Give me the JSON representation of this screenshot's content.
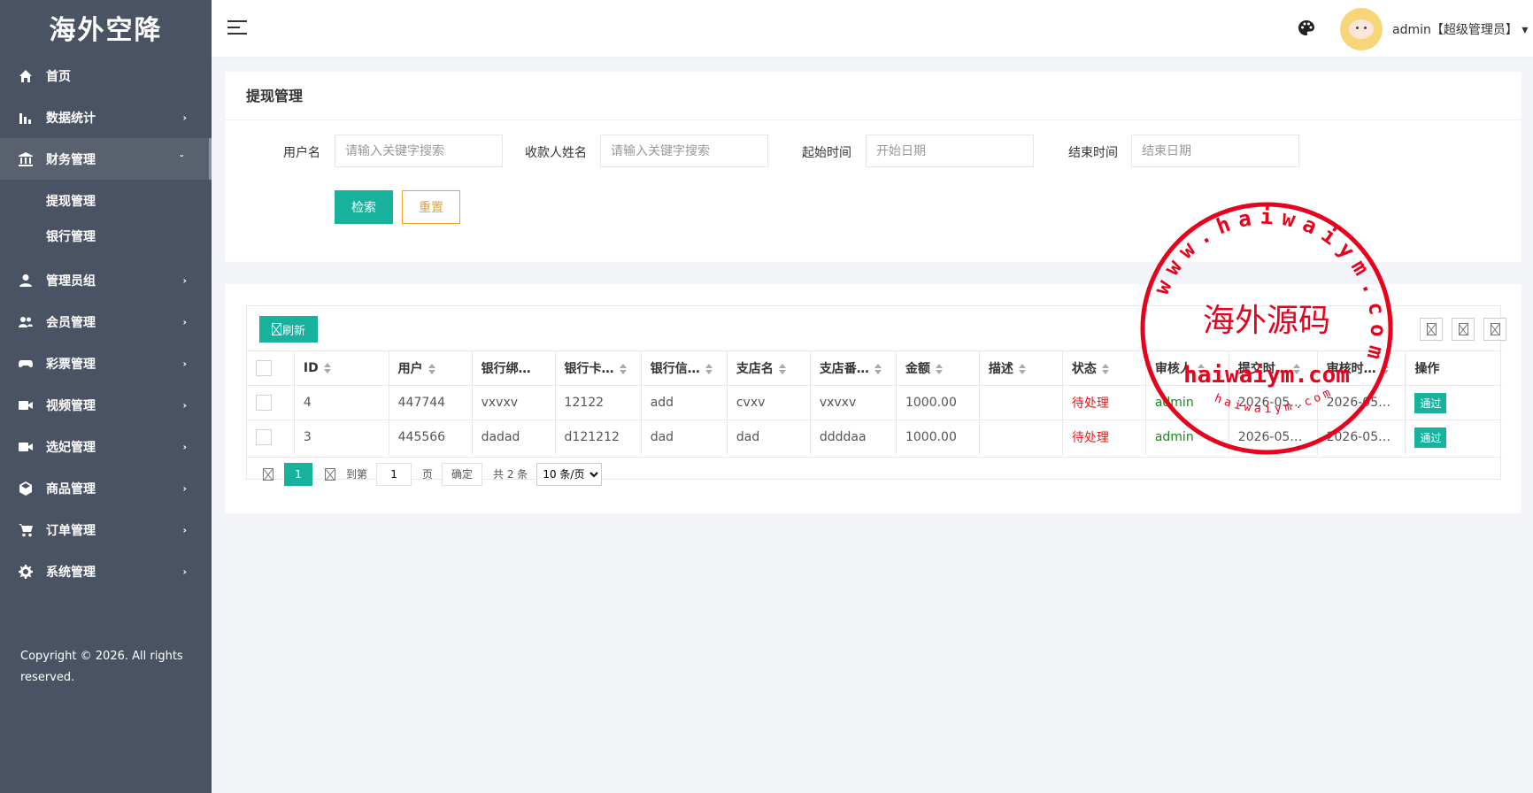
{
  "sidebar": {
    "brand": "海外空降",
    "items": [
      {
        "label": "首页",
        "icon": "home-icon"
      },
      {
        "label": "数据统计",
        "icon": "bar-chart-icon"
      },
      {
        "label": "财务管理",
        "icon": "bank-icon",
        "expanded": true
      },
      {
        "label": "管理员组",
        "icon": "user-icon"
      },
      {
        "label": "会员管理",
        "icon": "users-icon"
      },
      {
        "label": "彩票管理",
        "icon": "gamepad-icon"
      },
      {
        "label": "视频管理",
        "icon": "video-icon"
      },
      {
        "label": "选妃管理",
        "icon": "video-icon"
      },
      {
        "label": "商品管理",
        "icon": "cube-icon"
      },
      {
        "label": "订单管理",
        "icon": "cart-icon"
      },
      {
        "label": "系统管理",
        "icon": "gear-icon"
      }
    ],
    "subitems": [
      {
        "label": "提现管理"
      },
      {
        "label": "银行管理"
      }
    ],
    "copyright": "Copyright © 2026. All rights reserved."
  },
  "header": {
    "user": "admin【超级管理员】",
    "caret": "▾"
  },
  "search_panel": {
    "title": "提现管理",
    "fields": [
      {
        "label": "用户名",
        "placeholder": "请输入关键字搜索"
      },
      {
        "label": "收款人姓名",
        "placeholder": "请输入关键字搜索"
      },
      {
        "label": "起始时间",
        "placeholder": "开始日期"
      },
      {
        "label": "结束时间",
        "placeholder": "结束日期"
      }
    ],
    "search_button": "检索",
    "reset_button": "重置"
  },
  "table": {
    "refresh_button": "刷新",
    "columns": [
      "ID",
      "用户",
      "银行绑…",
      "银行卡…",
      "银行信…",
      "支店名",
      "支店番…",
      "金额",
      "描述",
      "状态",
      "审核人",
      "提交时…",
      "审核时…",
      "操作"
    ],
    "rows": [
      {
        "id": "4",
        "user": "447744",
        "bank_bind": "vxvxv",
        "bank_card": "12122",
        "bank_info": "add",
        "branch": "cvxv",
        "branch_no": "vxvxv",
        "amount": "1000.00",
        "desc": "",
        "status": "待处理",
        "auditor": "admin",
        "submit_time": "2026-05…",
        "audit_time": "2026-05…",
        "action": "通过"
      },
      {
        "id": "3",
        "user": "445566",
        "bank_bind": "dadad",
        "bank_card": "d121212",
        "bank_info": "dad",
        "branch": "dad",
        "branch_no": "ddddaa",
        "amount": "1000.00",
        "desc": "",
        "status": "待处理",
        "auditor": "admin",
        "submit_time": "2026-05…",
        "audit_time": "2026-05…",
        "action": "通过"
      }
    ]
  },
  "pagination": {
    "current": "1",
    "goto_label": "到第",
    "goto_value": "1",
    "page_unit": "页",
    "confirm": "确定",
    "total": "共 2 条",
    "page_size": "10 条/页"
  },
  "watermark": {
    "ring_text": "www.haiwaiym.com",
    "center_cn": "海外源码",
    "center_en": "haiwaiym.com",
    "small_text": "haiwaiym.com",
    "color": "#e8001c"
  },
  "colors": {
    "sidebar": "#4a5364",
    "accent": "#16b29e",
    "reset": "#f0a020",
    "pending": "#e31b1b",
    "auditor": "#158a15"
  }
}
